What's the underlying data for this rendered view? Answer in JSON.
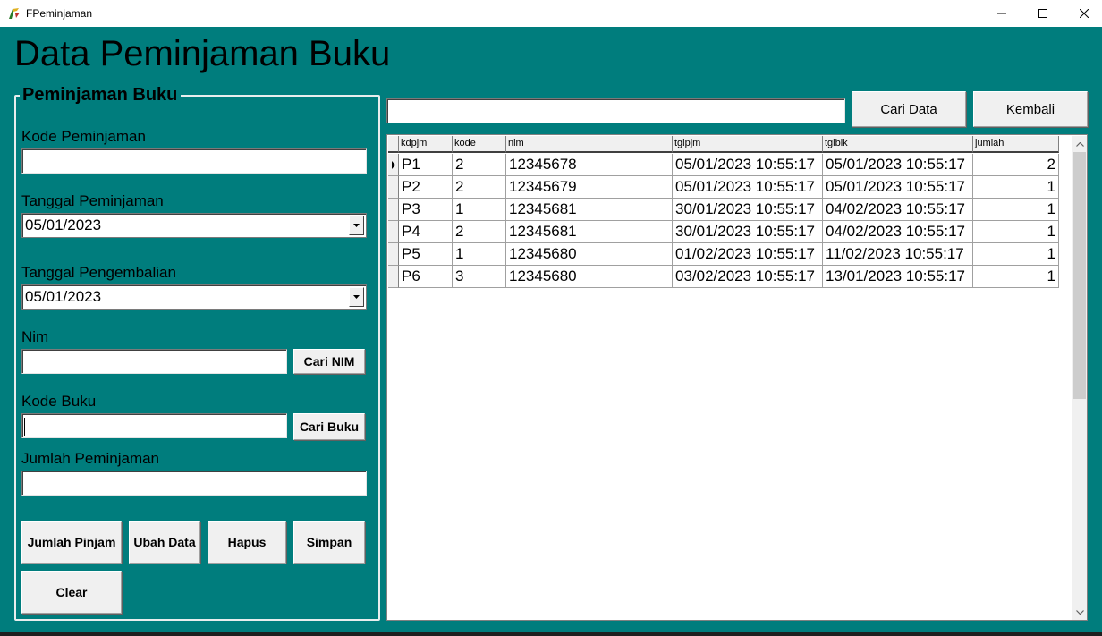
{
  "window": {
    "title": "FPeminjaman",
    "icon": "delphi-app-icon",
    "controls": [
      "minimize-icon",
      "maximize-icon",
      "close-icon"
    ]
  },
  "heading": "Data Peminjaman Buku",
  "form": {
    "group_title": "Peminjaman Buku",
    "kode_peminjaman": {
      "label": "Kode Peminjaman",
      "value": ""
    },
    "tanggal_peminjaman": {
      "label": "Tanggal Peminjaman",
      "value": "05/01/2023"
    },
    "tanggal_pengembalian": {
      "label": "Tanggal Pengembalian",
      "value": "05/01/2023"
    },
    "nim": {
      "label": "Nim",
      "value": "",
      "button": "Cari NIM"
    },
    "kode_buku": {
      "label": "Kode Buku",
      "value": "",
      "button": "Cari Buku"
    },
    "jumlah_peminjaman": {
      "label": "Jumlah Peminjaman",
      "value": ""
    },
    "buttons": {
      "jumlah_pinjam": "Jumlah Pinjam",
      "ubah_data": "Ubah Data",
      "hapus": "Hapus",
      "simpan": "Simpan",
      "clear": "Clear"
    }
  },
  "search": {
    "value": "",
    "cari_data": "Cari Data",
    "kembali": "Kembali"
  },
  "table": {
    "columns": [
      "kdpjm",
      "kode",
      "nim",
      "tglpjm",
      "tglblk",
      "jumlah"
    ],
    "rows": [
      [
        "P1",
        "2",
        "12345678",
        "05/01/2023 10:55:17",
        "05/01/2023 10:55:17",
        "2"
      ],
      [
        "P2",
        "2",
        "12345679",
        "05/01/2023 10:55:17",
        "05/01/2023 10:55:17",
        "1"
      ],
      [
        "P3",
        "1",
        "12345681",
        "30/01/2023 10:55:17",
        "04/02/2023 10:55:17",
        "1"
      ],
      [
        "P4",
        "2",
        "12345681",
        "30/01/2023 10:55:17",
        "04/02/2023 10:55:17",
        "1"
      ],
      [
        "P5",
        "1",
        "12345680",
        "01/02/2023 10:55:17",
        "11/02/2023 10:55:17",
        "1"
      ],
      [
        "P6",
        "3",
        "12345680",
        "03/02/2023 10:55:17",
        "13/01/2023 10:55:17",
        "1"
      ]
    ],
    "selected_row": 0
  },
  "colors": {
    "background": "#007d7d",
    "button_face": "#f0f0f0"
  }
}
